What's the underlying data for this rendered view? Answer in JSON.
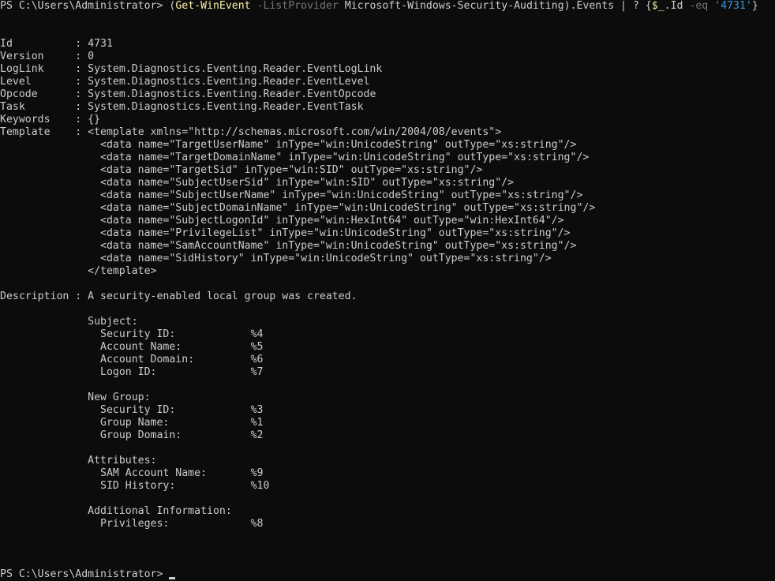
{
  "prompt": {
    "text": "PS C:\\Users\\Administrator> ",
    "open_paren": "(",
    "cmdlet": "Get-WinEvent",
    "param": " -ListProvider",
    "provider": " Microsoft-Windows-Security-Auditing",
    "rest": ").Events | ? {",
    "var": "$_",
    "prop": ".Id",
    "param_eq": " -eq",
    "value": " '4731'",
    "close": "}"
  },
  "properties": [
    {
      "key": "Id",
      "value": "4731"
    },
    {
      "key": "Version",
      "value": "0"
    },
    {
      "key": "LogLink",
      "value": "System.Diagnostics.Eventing.Reader.EventLogLink"
    },
    {
      "key": "Level",
      "value": "System.Diagnostics.Eventing.Reader.EventLevel"
    },
    {
      "key": "Opcode",
      "value": "System.Diagnostics.Eventing.Reader.EventOpcode"
    },
    {
      "key": "Task",
      "value": "System.Diagnostics.Eventing.Reader.EventTask"
    },
    {
      "key": "Keywords",
      "value": "{}"
    },
    {
      "key": "Template",
      "value": "<template xmlns=\"http://schemas.microsoft.com/win/2004/08/events\">"
    }
  ],
  "template_lines": [
    "  <data name=\"TargetUserName\" inType=\"win:UnicodeString\" outType=\"xs:string\"/>",
    "  <data name=\"TargetDomainName\" inType=\"win:UnicodeString\" outType=\"xs:string\"/>",
    "  <data name=\"TargetSid\" inType=\"win:SID\" outType=\"xs:string\"/>",
    "  <data name=\"SubjectUserSid\" inType=\"win:SID\" outType=\"xs:string\"/>",
    "  <data name=\"SubjectUserName\" inType=\"win:UnicodeString\" outType=\"xs:string\"/>",
    "  <data name=\"SubjectDomainName\" inType=\"win:UnicodeString\" outType=\"xs:string\"/>",
    "  <data name=\"SubjectLogonId\" inType=\"win:HexInt64\" outType=\"win:HexInt64\"/>",
    "  <data name=\"PrivilegeList\" inType=\"win:UnicodeString\" outType=\"xs:string\"/>",
    "  <data name=\"SamAccountName\" inType=\"win:UnicodeString\" outType=\"xs:string\"/>",
    "  <data name=\"SidHistory\" inType=\"win:UnicodeString\" outType=\"xs:string\"/>",
    "</template>"
  ],
  "description": {
    "key": "Description",
    "value": "A security-enabled local group was created."
  },
  "description_lines": [
    "",
    "Subject:",
    "  Security ID:            %4",
    "  Account Name:           %5",
    "  Account Domain:         %6",
    "  Logon ID:               %7",
    "",
    "New Group:",
    "  Security ID:            %3",
    "  Group Name:             %1",
    "  Group Domain:           %2",
    "",
    "Attributes:",
    "  SAM Account Name:       %9",
    "  SID History:            %10",
    "",
    "Additional Information:",
    "  Privileges:             %8"
  ],
  "final_prompt": "PS C:\\Users\\Administrator> ",
  "colors": {
    "background": "#0c0c0c",
    "foreground": "#cccccc",
    "cmdlet": "#f9f1a5",
    "parameter": "#767676",
    "string": "#3a96dd"
  }
}
